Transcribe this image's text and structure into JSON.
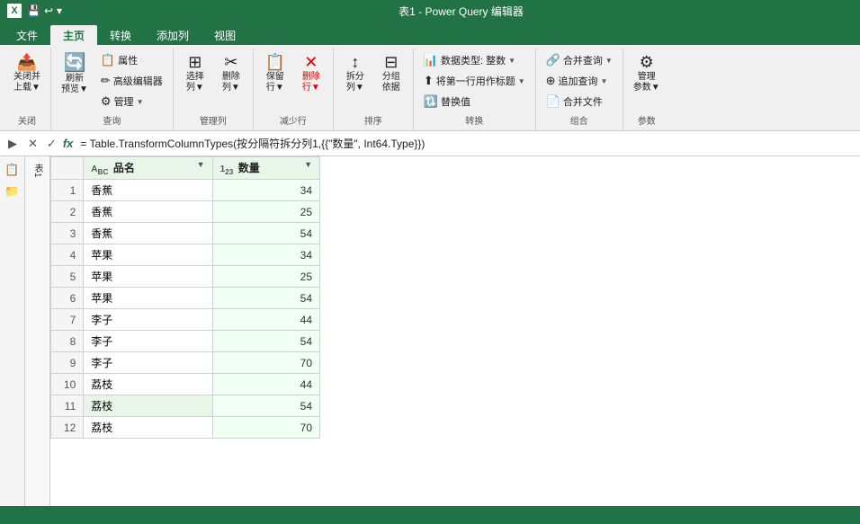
{
  "titlebar": {
    "title": "表1 - Power Query 编辑器",
    "excel_icon": "X",
    "quick_access": [
      "💾",
      "↩",
      "▾"
    ]
  },
  "ribbon_tabs": [
    {
      "label": "文件",
      "active": false
    },
    {
      "label": "主页",
      "active": true
    },
    {
      "label": "转换",
      "active": false
    },
    {
      "label": "添加列",
      "active": false
    },
    {
      "label": "视图",
      "active": false
    }
  ],
  "ribbon": {
    "groups": [
      {
        "name": "关闭",
        "label": "关闭",
        "buttons": [
          {
            "icon": "📤",
            "label": "关闭并\n上载▼",
            "type": "large"
          }
        ]
      },
      {
        "name": "查询",
        "label": "查询",
        "buttons": [
          {
            "icon": "🔄",
            "label": "刷新\n预览▼",
            "type": "large"
          },
          {
            "icon": "📋",
            "label": "属性",
            "type": "small"
          },
          {
            "icon": "✏",
            "label": "高级编辑器",
            "type": "small"
          },
          {
            "icon": "⚙",
            "label": "管理▼",
            "type": "small"
          }
        ]
      },
      {
        "name": "管理列",
        "label": "管理列",
        "buttons": [
          {
            "icon": "⊞",
            "label": "选择\n列▼",
            "type": "large"
          },
          {
            "icon": "✂",
            "label": "删除\n列▼",
            "type": "large"
          }
        ]
      },
      {
        "name": "减少行",
        "label": "减少行",
        "buttons": [
          {
            "icon": "⋮",
            "label": "保留\n行▼",
            "type": "large"
          },
          {
            "icon": "✕",
            "label": "删除\n行▼",
            "type": "large"
          }
        ]
      },
      {
        "name": "排序",
        "label": "排序",
        "buttons": [
          {
            "icon": "↕",
            "label": "拆分\n列▼",
            "type": "large"
          },
          {
            "icon": "⊟",
            "label": "分组\n依据",
            "type": "large"
          }
        ]
      },
      {
        "name": "转换",
        "label": "转换",
        "buttons": [
          {
            "icon": "📊",
            "label": "数据类型: 整数▼",
            "type": "small"
          },
          {
            "icon": "⬆",
            "label": "将第一行用作标题▼",
            "type": "small"
          },
          {
            "icon": "🔃",
            "label": "替换值",
            "type": "small"
          }
        ]
      },
      {
        "name": "组合",
        "label": "组合",
        "buttons": [
          {
            "icon": "🔗",
            "label": "合并查询▼",
            "type": "small"
          },
          {
            "icon": "⊕",
            "label": "追加查询▼",
            "type": "small"
          },
          {
            "icon": "📄",
            "label": "合并文件",
            "type": "small"
          }
        ]
      },
      {
        "name": "参数",
        "label": "参数",
        "buttons": [
          {
            "icon": "⚙",
            "label": "管理\n参数▼",
            "type": "large"
          }
        ]
      }
    ]
  },
  "formula_bar": {
    "formula": "= Table.TransformColumnTypes(按分隔符拆分列1,{{\"数量\", Int64.Type}})"
  },
  "columns": [
    {
      "type_icon": "ABC",
      "name": "品名",
      "has_filter": true
    },
    {
      "type_icon": "123",
      "name": "数量",
      "has_filter": true
    }
  ],
  "rows": [
    {
      "num": 1,
      "name": "香蕉",
      "qty": 34,
      "highlight": false
    },
    {
      "num": 2,
      "name": "香蕉",
      "qty": 25,
      "highlight": false
    },
    {
      "num": 3,
      "name": "香蕉",
      "qty": 54,
      "highlight": false
    },
    {
      "num": 4,
      "name": "苹果",
      "qty": 34,
      "highlight": false
    },
    {
      "num": 5,
      "name": "苹果",
      "qty": 25,
      "highlight": false
    },
    {
      "num": 6,
      "name": "苹果",
      "qty": 54,
      "highlight": false
    },
    {
      "num": 7,
      "name": "李子",
      "qty": 44,
      "highlight": false
    },
    {
      "num": 8,
      "name": "李子",
      "qty": 54,
      "highlight": false
    },
    {
      "num": 9,
      "name": "李子",
      "qty": 70,
      "highlight": false
    },
    {
      "num": 10,
      "name": "荔枝",
      "qty": 44,
      "highlight": false
    },
    {
      "num": 11,
      "name": "荔枝",
      "qty": 54,
      "highlight": true
    },
    {
      "num": 12,
      "name": "荔枝",
      "qty": 70,
      "highlight": false
    }
  ],
  "statusbar": {
    "text": ""
  },
  "sidebar": {
    "icons": [
      "📋",
      "📁"
    ]
  },
  "colors": {
    "header_bg": "#217346",
    "ribbon_bg": "#f0f0f0",
    "cell_number_bg": "#f0fff4",
    "row_highlight": "#e8f5e9",
    "accent": "#217346"
  }
}
